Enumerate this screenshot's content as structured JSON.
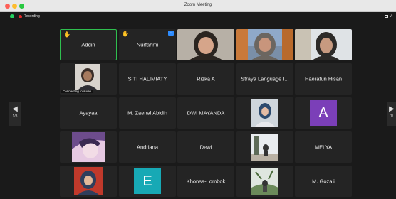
{
  "window": {
    "title": "Zoom Meeting"
  },
  "topbar": {
    "recording_label": "Recording",
    "view_label": "Vi"
  },
  "pager": {
    "left_page": "1/3",
    "right_page": "1/"
  },
  "participants": [
    {
      "name": "Addin",
      "hand_raised": true,
      "active_speaker": true
    },
    {
      "name": "Nurfahmi",
      "hand_raised": true,
      "has_control_badge": true
    },
    {
      "name": "",
      "video": true
    },
    {
      "name": "",
      "video": true
    },
    {
      "name": "",
      "video": true
    },
    {
      "name": "",
      "video": true,
      "status": "Connecting to audio"
    },
    {
      "name": "SITI HALIMIATY"
    },
    {
      "name": "Rizka A"
    },
    {
      "name": "Straya Language I..."
    },
    {
      "name": "Haeratun Hisan"
    },
    {
      "name": "Ayayaa"
    },
    {
      "name": "M. Zaenal Abidin"
    },
    {
      "name": "DWI MAYANDA"
    },
    {
      "name": "",
      "photo": true
    },
    {
      "name": "",
      "avatar_letter": "A",
      "avatar_color": "#7b3fb8"
    },
    {
      "name": "",
      "photo": true
    },
    {
      "name": "Andriana"
    },
    {
      "name": "Dewi"
    },
    {
      "name": "",
      "photo": true
    },
    {
      "name": "MELYA"
    },
    {
      "name": "",
      "photo": true
    },
    {
      "name": "",
      "avatar_letter": "E",
      "avatar_color": "#17a9b5"
    },
    {
      "name": "Khonsa-Lombok"
    },
    {
      "name": "",
      "photo": true
    },
    {
      "name": "M. Gozali"
    }
  ],
  "colors": {
    "active_border": "#2fbf4f",
    "hand": "#f5c542",
    "badge": "#2d8cff"
  }
}
